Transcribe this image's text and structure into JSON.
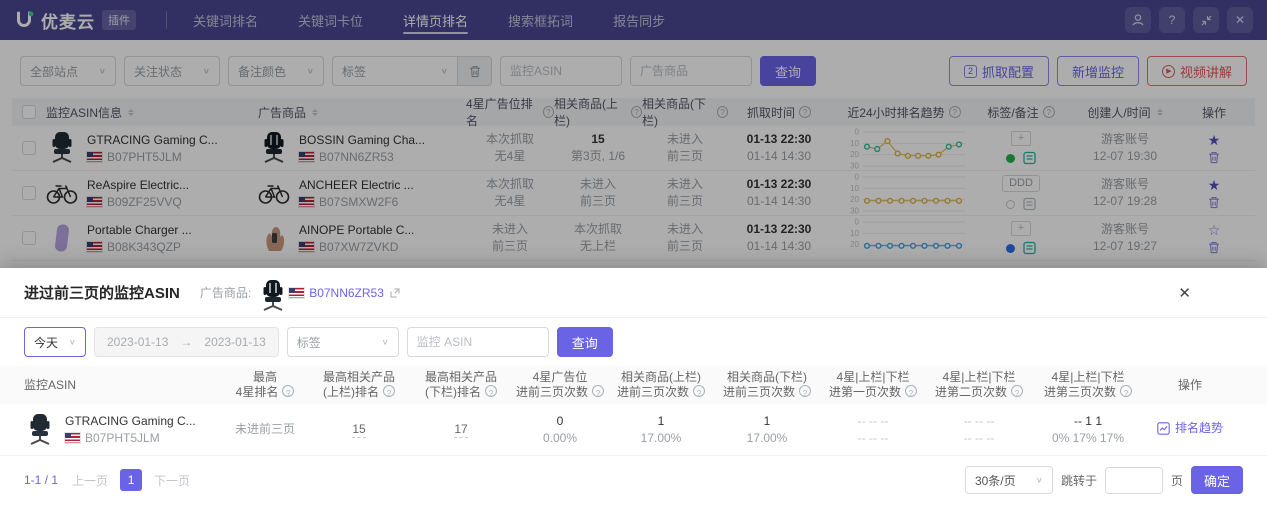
{
  "colors": {
    "accent": "#6b63e6",
    "danger": "#e05a5a",
    "navbar": "#4a4792"
  },
  "icons": {
    "plus": "+",
    "close": "✕",
    "question": "?",
    "chevron": "∨",
    "arrow_right": "→",
    "play": "▶",
    "info": "?",
    "config_num": "2"
  },
  "topbar": {
    "logo_text": "优麦云",
    "logo_badge": "插件",
    "menu": [
      {
        "label": "关键词排名"
      },
      {
        "label": "关键词卡位"
      },
      {
        "label": "详情页排名"
      },
      {
        "label": "搜索框拓词"
      },
      {
        "label": "报告同步"
      }
    ]
  },
  "filter_bar": {
    "site_select": "全部站点",
    "follow_select": "关注状态",
    "color_select": "备注颜色",
    "tag_select": "标签",
    "asin_placeholder": "监控ASIN",
    "ad_placeholder": "广告商品",
    "query_button": "查询",
    "capture_button": "抓取配置",
    "add_button": "新增监控",
    "video_button": "视频讲解"
  },
  "main_table": {
    "headers": {
      "asin": "监控ASIN信息",
      "ad": "广告商品",
      "star_rank": "4星广告位排名",
      "upper": "相关商品(上栏)",
      "lower": "相关商品(下栏)",
      "time": "抓取时间",
      "trend": "近24小时排名趋势",
      "tags": "标签/备注",
      "creator": "创建人/时间",
      "ops": "操作"
    },
    "rows": [
      {
        "asin": {
          "title": "GTRACING Gaming C...",
          "code": "B07PHT5JLM",
          "image": "gaming-chair"
        },
        "ad": {
          "title": "BOSSIN Gaming Cha...",
          "code": "B07NN6ZR53",
          "image": "gaming-chair-2"
        },
        "star_rank": {
          "l1": "本次抓取",
          "l2": "无4星",
          "emph": ""
        },
        "upper": {
          "l1": "15",
          "l2": "第3页, 1/6",
          "emph": "strong"
        },
        "lower": {
          "l1": "未进入",
          "l2": "前三页",
          "emph": ""
        },
        "time": {
          "l1": "01-13 22:30",
          "l2": "01-14 14:30",
          "emph": "strong"
        },
        "trend": {
          "ticks": [
            "0",
            "10",
            "20",
            "30"
          ],
          "max": 30,
          "points": [
            13,
            15,
            8,
            19,
            21,
            21,
            21,
            20,
            13,
            11
          ],
          "colors": [
            "#2fbf9a",
            "#2fbf9a",
            "#ddb53e",
            "#ddb53e",
            "#ddb53e",
            "#ddb53e",
            "#ddb53e",
            "#ddb53e",
            "#2fbf9a",
            "#2fbf9a"
          ],
          "line": "#ddb53e"
        },
        "tags": {
          "dot": "green",
          "note": "teal"
        },
        "creator": {
          "name": "游客账号",
          "time": "12-07 19:30"
        },
        "ops": {
          "star": "filled"
        }
      },
      {
        "asin": {
          "title": "ReAspire Electric...",
          "code": "B09ZF25VVQ",
          "image": "bike"
        },
        "ad": {
          "title": "ANCHEER Electric ...",
          "code": "B07SMXW2F6",
          "image": "bike"
        },
        "star_rank": {
          "l1": "本次抓取",
          "l2": "无4星",
          "emph": ""
        },
        "upper": {
          "l1": "未进入",
          "l2": "前三页",
          "emph": ""
        },
        "lower": {
          "l1": "未进入",
          "l2": "前三页",
          "emph": ""
        },
        "time": {
          "l1": "01-13 22:30",
          "l2": "01-14 14:30",
          "emph": "strong"
        },
        "trend": {
          "ticks": [
            "0",
            "10",
            "20",
            "30"
          ],
          "max": 30,
          "points": [
            21,
            21,
            21,
            21,
            21,
            21,
            21,
            21,
            21
          ],
          "colors": [
            "#ddb53e",
            "#ddb53e",
            "#ddb53e",
            "#ddb53e",
            "#ddb53e",
            "#ddb53e",
            "#ddb53e",
            "#ddb53e",
            "#ddb53e"
          ],
          "line": "#ddb53e"
        },
        "tags": {
          "tag": "DDD",
          "dot": "hollow",
          "note": "grey"
        },
        "creator": {
          "name": "游客账号",
          "time": "12-07 19:28"
        },
        "ops": {
          "star": "filled"
        }
      },
      {
        "asin": {
          "title": "Portable Charger ...",
          "code": "B08K343QZP",
          "image": "powerbank"
        },
        "ad": {
          "title": "AINOPE Portable C...",
          "code": "B07XW7ZVKD",
          "image": "hand"
        },
        "star_rank": {
          "l1": "未进入",
          "l2": "前三页",
          "emph": ""
        },
        "upper": {
          "l1": "本次抓取",
          "l2": "无上栏",
          "emph": ""
        },
        "lower": {
          "l1": "未进入",
          "l2": "前三页",
          "emph": ""
        },
        "time": {
          "l1": "01-13 22:30",
          "l2": "01-14 14:30",
          "emph": "strong"
        },
        "trend": {
          "ticks": [
            "0",
            "10",
            "20"
          ],
          "max": 30,
          "points": [
            21,
            21,
            21,
            21,
            21,
            21,
            21,
            21,
            21
          ],
          "colors": [
            "#3f9fe0",
            "#3f9fe0",
            "#3f9fe0",
            "#3f9fe0",
            "#3f9fe0",
            "#3f9fe0",
            "#3f9fe0",
            "#3f9fe0",
            "#3f9fe0"
          ],
          "line": "#3f9fe0"
        },
        "tags": {
          "dot": "blue",
          "note": "teal"
        },
        "creator": {
          "name": "游客账号",
          "time": "12-07 19:27"
        },
        "ops": {
          "star": "outline"
        }
      }
    ]
  },
  "modal": {
    "title": "进过前三页的监控ASIN",
    "ad_label": "广告商品:",
    "ad_code": "B07NN6ZR53",
    "ad_image": "gaming-chair-2",
    "filters": {
      "range_preset": "今天",
      "date_from": "2023-01-13",
      "date_to": "2023-01-13",
      "tag_placeholder": "标签",
      "asin_placeholder": "监控 ASIN",
      "query_button": "查询"
    },
    "table": {
      "headers": [
        {
          "l1": "监控ASIN",
          "l2": ""
        },
        {
          "l1": "最高",
          "l2": "4星排名"
        },
        {
          "l1": "最高相关产品",
          "l2": "(上栏)排名"
        },
        {
          "l1": "最高相关产品",
          "l2": "(下栏)排名"
        },
        {
          "l1": "4星广告位",
          "l2": "进前三页次数"
        },
        {
          "l1": "相关商品(上栏)",
          "l2": "进前三页次数"
        },
        {
          "l1": "相关商品(下栏)",
          "l2": "进前三页次数"
        },
        {
          "l1": "4星|上栏|下栏",
          "l2": "进第一页次数"
        },
        {
          "l1": "4星|上栏|下栏",
          "l2": "进第二页次数"
        },
        {
          "l1": "4星|上栏|下栏",
          "l2": "进第三页次数"
        },
        {
          "l1": "操作",
          "l2": ""
        }
      ],
      "row": {
        "asin": {
          "title": "GTRACING Gaming C...",
          "code": "B07PHT5JLM",
          "image": "gaming-chair"
        },
        "best_star": "未进前三页",
        "best_upper": "15",
        "best_lower": "17",
        "star_top3": {
          "count": "0",
          "pct": "0.00%"
        },
        "upper_top3": {
          "count": "1",
          "pct": "17.00%"
        },
        "lower_top3": {
          "count": "1",
          "pct": "17.00%"
        },
        "page1": {
          "count": "-- -- --",
          "pct": "-- -- --"
        },
        "page2": {
          "count": "-- -- --",
          "pct": "-- -- --"
        },
        "page3": {
          "count": "-- 1 1",
          "pct": "0% 17% 17%"
        },
        "action": "排名趋势"
      }
    },
    "pagination": {
      "range": "1-1 / 1",
      "prev": "上一页",
      "page": "1",
      "next": "下一页",
      "page_size": "30条/页",
      "jump_label": "跳转于",
      "page_unit": "页",
      "confirm": "确定"
    }
  }
}
